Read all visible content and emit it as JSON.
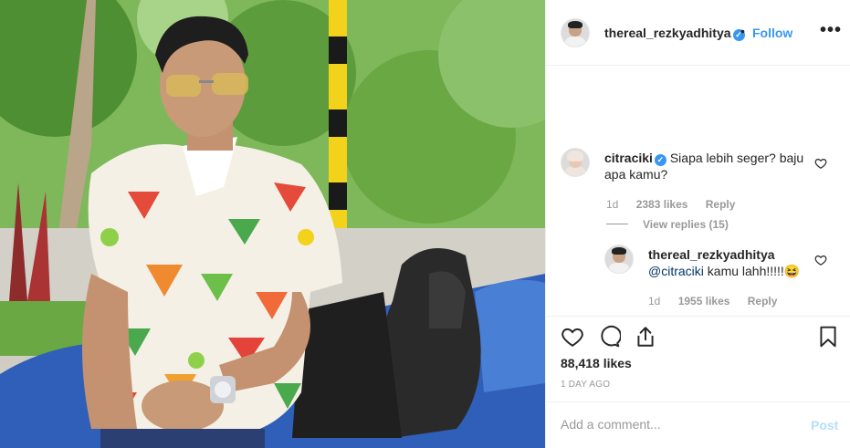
{
  "post": {
    "author": "thereal_rezkyadhitya",
    "follow_label": "Follow",
    "separator": "•",
    "more_label": "•••"
  },
  "comments": [
    {
      "username": "citraciki",
      "text": "Siapa lebih seger? baju apa kamu?",
      "age": "1d",
      "likes": "2383 likes",
      "reply_label": "Reply",
      "view_replies": "View replies (15)"
    },
    {
      "username": "thereal_rezkyadhitya",
      "mention": "@citraciki",
      "text": " kamu lahh!!!!!😆",
      "age": "1d",
      "likes": "1955 likes",
      "reply_label": "Reply"
    }
  ],
  "actions": {
    "like_icon": "heart-outline-icon",
    "comment_icon": "comment-bubble-icon",
    "share_icon": "share-icon",
    "save_icon": "bookmark-icon"
  },
  "stats": {
    "likes": "88,418 likes",
    "time": "1 DAY AGO"
  },
  "composer": {
    "placeholder": "Add a comment...",
    "post_label": "Post"
  },
  "colors": {
    "link_blue": "#3897f0",
    "verified_blue": "#3897f0",
    "post_disabled": "#b2dffc",
    "muted_text": "#999999"
  }
}
